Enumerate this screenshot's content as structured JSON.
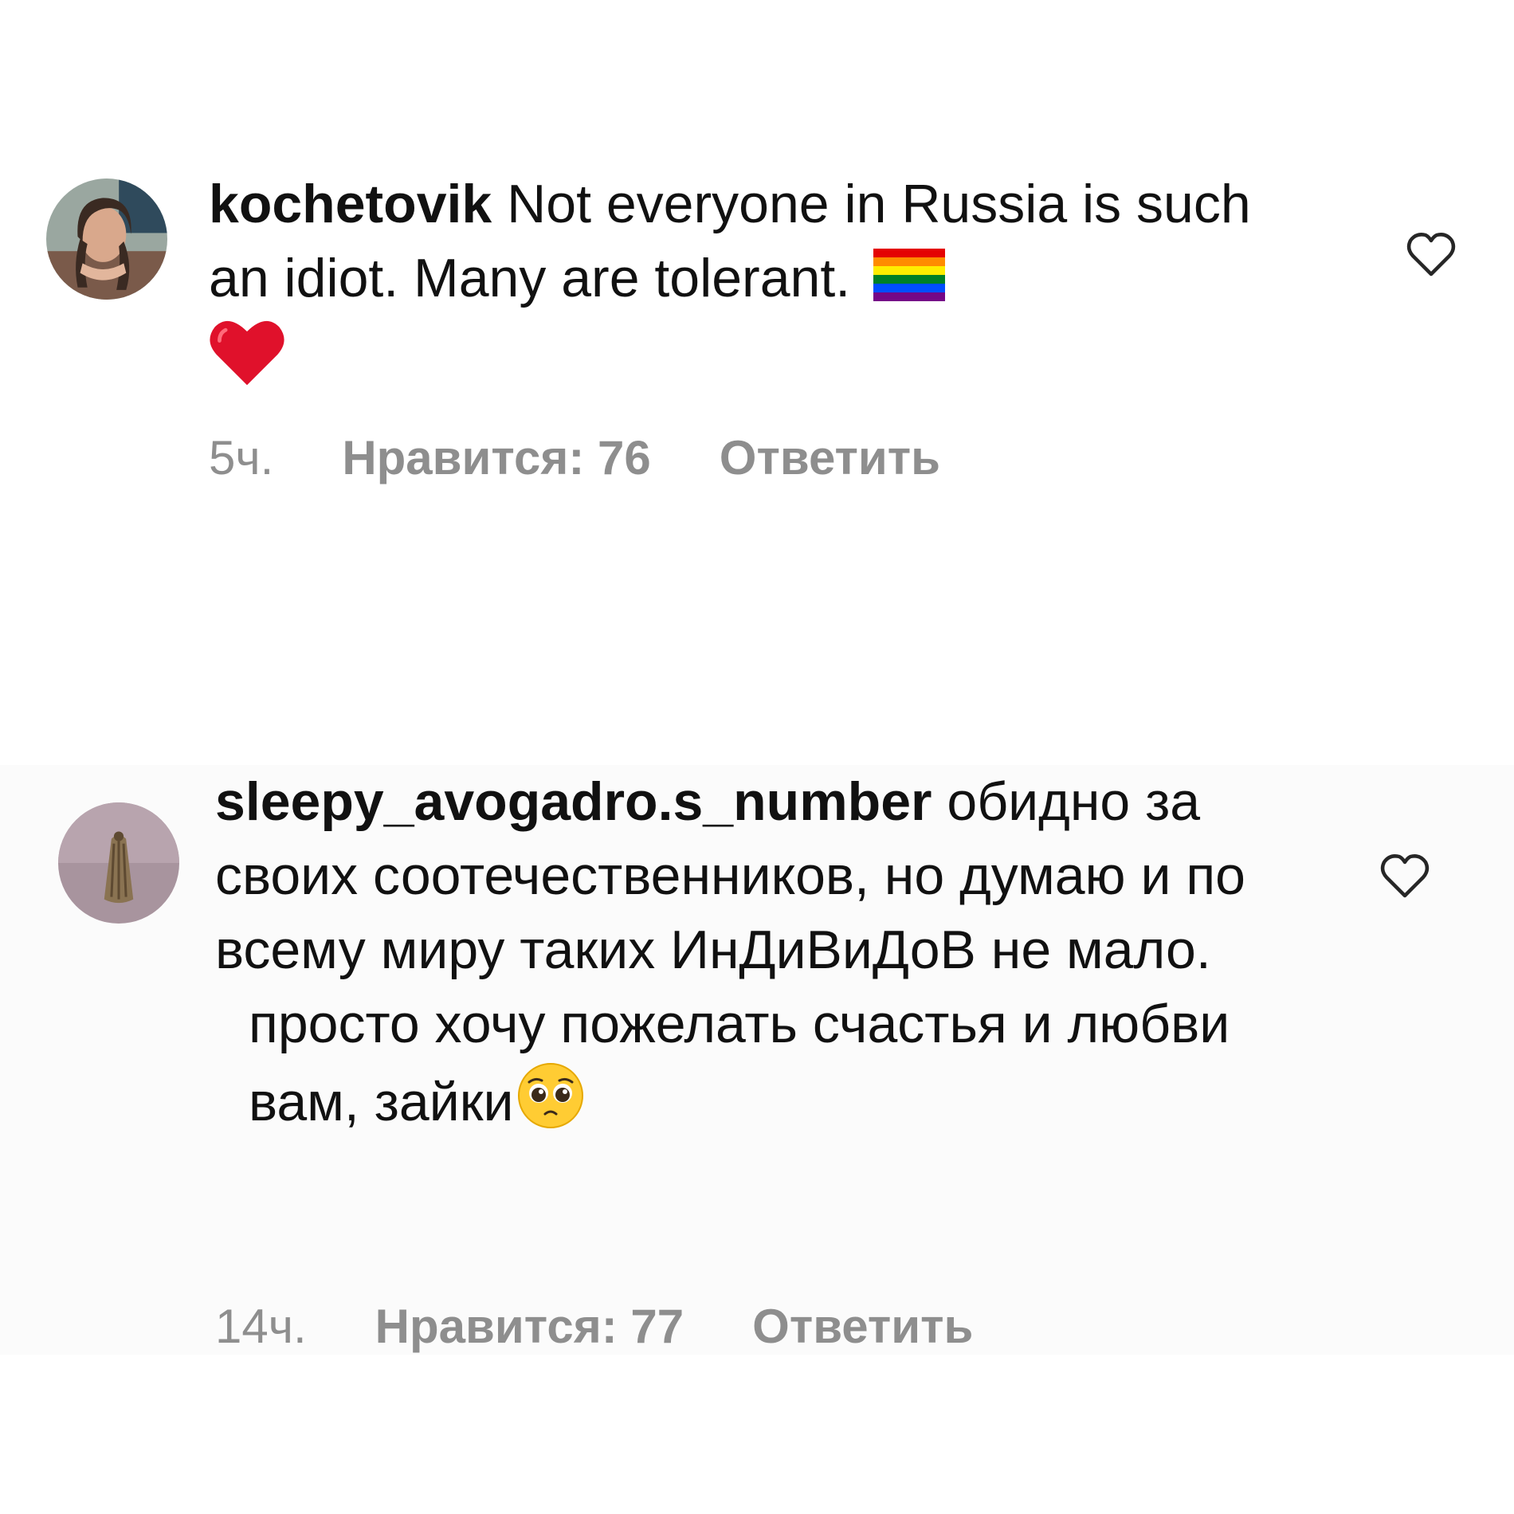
{
  "comments": [
    {
      "username": "kochetovik",
      "text": "Not everyone in Russia is such an idiot. Many are tolerant.",
      "emojis": [
        "rainbow-flag-icon",
        "red-heart-icon"
      ],
      "time": "5ч.",
      "likes": "Нравится: 76",
      "reply": "Ответить",
      "like_icon": "heart-outline-icon"
    },
    {
      "username": "sleepy_avogadro.s_number",
      "text_part1": "обидно за своих соотечественников, но думаю и по всему миру таких ИнДиВиДоВ не мало.",
      "text_part2": "просто хочу пожелать счастья и любви вам, зайки",
      "emojis": [
        "pleading-face-icon"
      ],
      "time": "14ч.",
      "likes": "Нравится: 77",
      "reply": "Ответить",
      "like_icon": "heart-outline-icon"
    }
  ],
  "colors": {
    "text": "#111111",
    "meta": "#8e8e8e",
    "background": "#ffffff",
    "second_comment_background": "#fbfbfb"
  }
}
